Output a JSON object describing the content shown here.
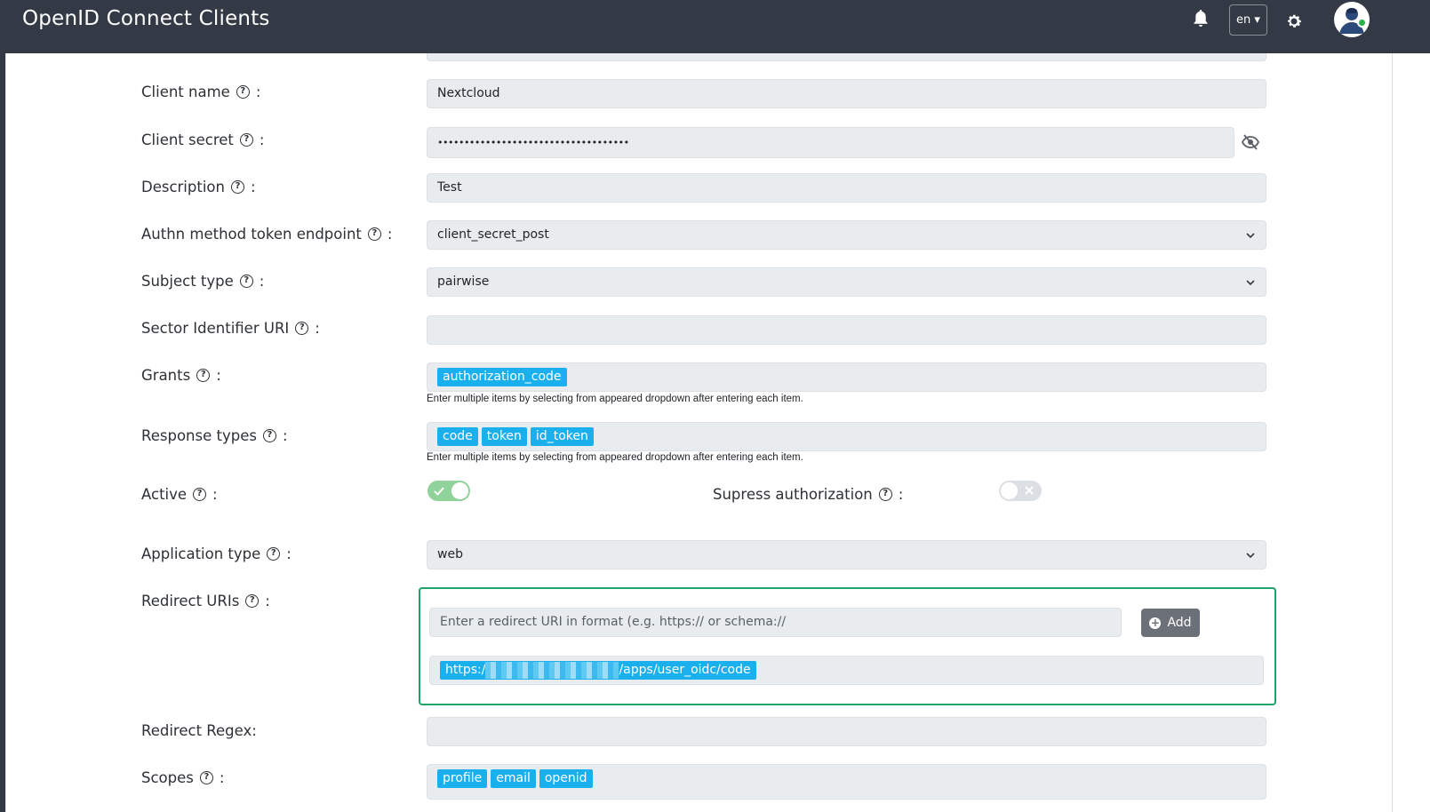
{
  "header": {
    "title": "OpenID Connect Clients",
    "language": "en",
    "icons": [
      "bell-icon",
      "gear-icon",
      "avatar"
    ]
  },
  "form": {
    "client_name": {
      "label": "Client name",
      "value": "Nextcloud"
    },
    "client_secret": {
      "label": "Client secret",
      "value": "••••••••••••••••••••••••••••••••••••"
    },
    "description": {
      "label": "Description",
      "value": "Test"
    },
    "authn_method": {
      "label": "Authn method token endpoint",
      "value": "client_secret_post"
    },
    "subject_type": {
      "label": "Subject type",
      "value": "pairwise"
    },
    "sector_identifier_uri": {
      "label": "Sector Identifier URI",
      "value": ""
    },
    "grants": {
      "label": "Grants",
      "tags": [
        "authorization_code"
      ],
      "hint": "Enter multiple items by selecting from appeared dropdown after entering each item."
    },
    "response_types": {
      "label": "Response types",
      "tags": [
        "code",
        "token",
        "id_token"
      ],
      "hint": "Enter multiple items by selecting from appeared dropdown after entering each item."
    },
    "active": {
      "label": "Active",
      "on": true
    },
    "supress_authorization": {
      "label": "Supress authorization",
      "on": false
    },
    "application_type": {
      "label": "Application type",
      "value": "web"
    },
    "redirect_uris": {
      "label": "Redirect URIs",
      "placeholder": "Enter a redirect URI in format (e.g. https:// or schema://",
      "add_label": "Add",
      "uri_prefix": "https:/",
      "uri_suffix": "/apps/user_oidc/code"
    },
    "redirect_regex": {
      "label": "Redirect Regex:",
      "value": ""
    },
    "scopes": {
      "label": "Scopes",
      "tags": [
        "profile",
        "email",
        "openid"
      ]
    }
  },
  "colors": {
    "header_bg": "#343a45",
    "tag_bg": "#1ab0ee",
    "toggle_on": "#8fd29a",
    "highlight_border": "#20a36a"
  },
  "colon": ":"
}
